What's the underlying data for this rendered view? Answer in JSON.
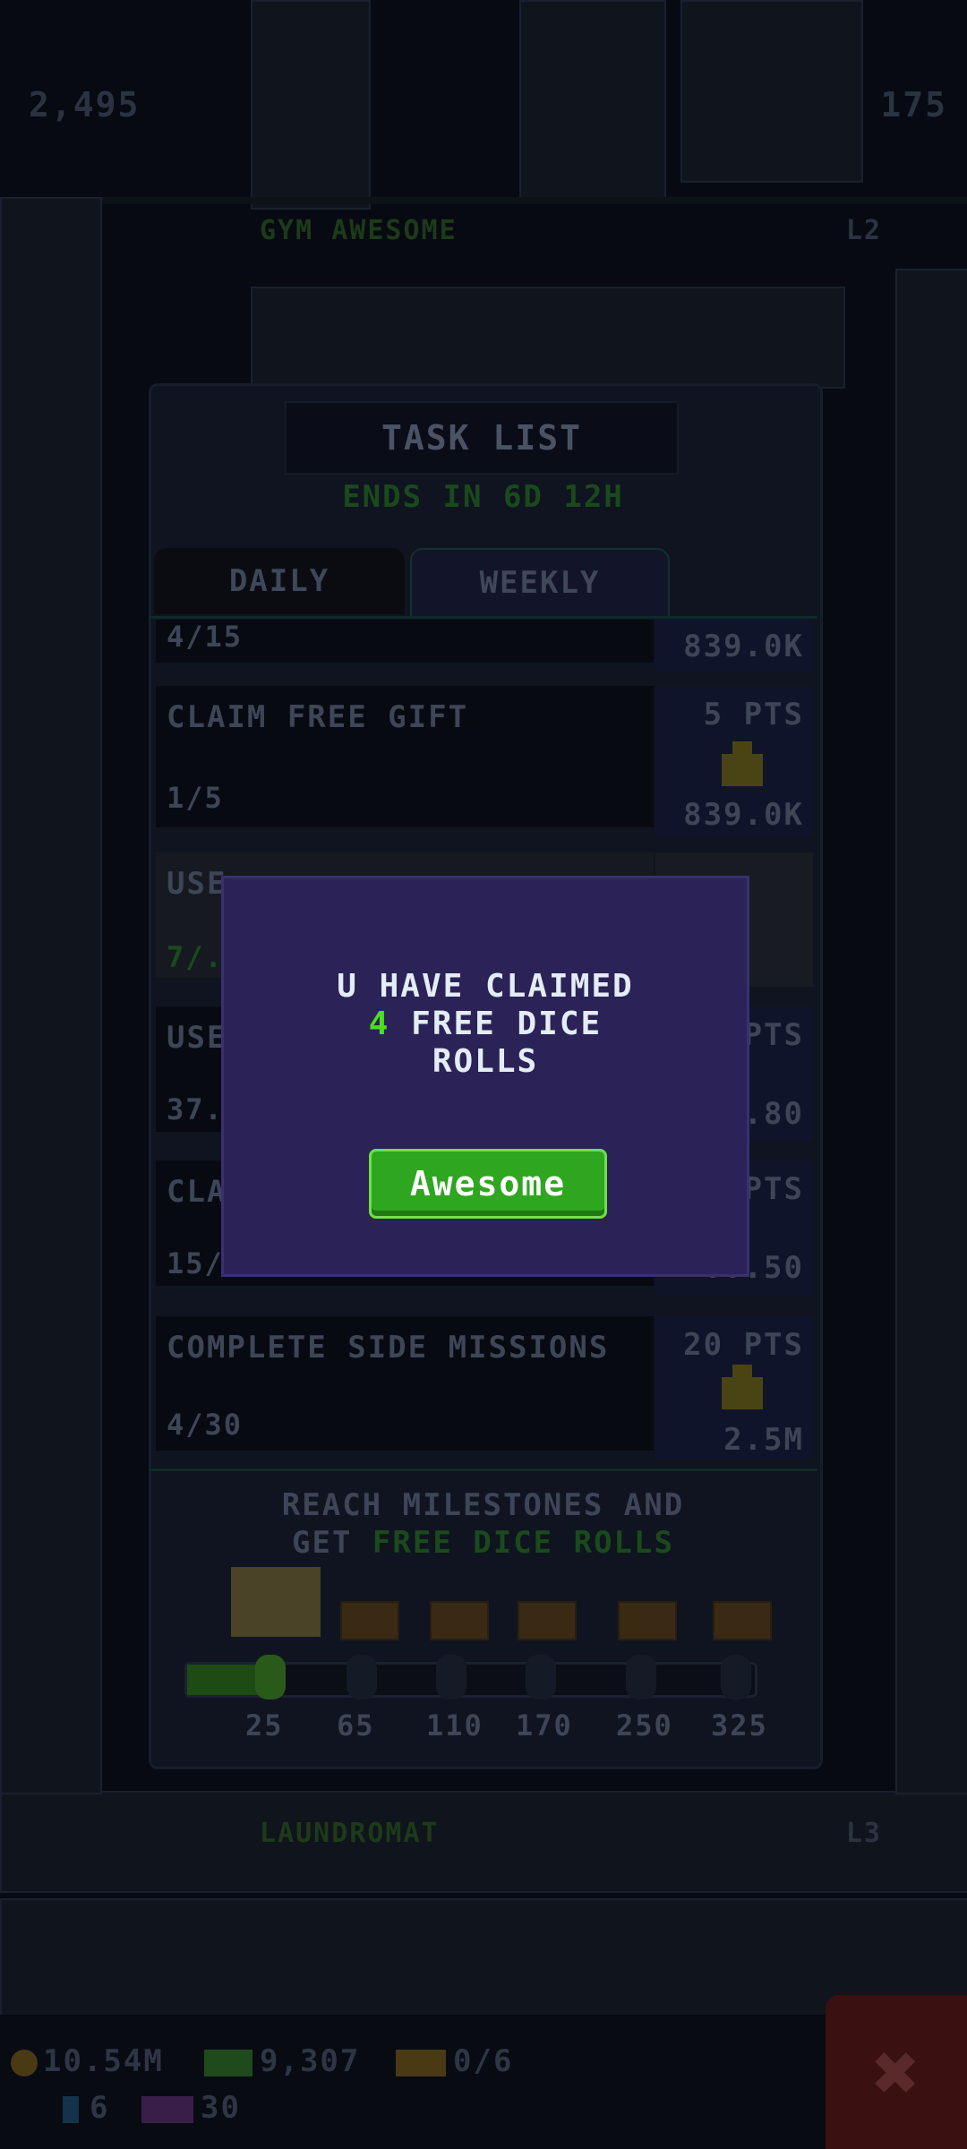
{
  "top": {
    "left_counter": "2,495",
    "right_counter": "175"
  },
  "floors": {
    "first_label": "Gym Awesome",
    "first_level": "L2",
    "bottom_label": "Laundromat",
    "bottom_level": "L3"
  },
  "task_list": {
    "title": "Task List",
    "ends_in": "Ends in 6d 12h",
    "tabs": [
      {
        "label": "Daily",
        "active": false
      },
      {
        "label": "Weekly",
        "active": true
      }
    ],
    "tasks": [
      {
        "name": "",
        "progress": "4/15",
        "points": "",
        "reward": "839.0K"
      },
      {
        "name": "Claim Free Gift",
        "progress": "1/5",
        "points": "5 PTS",
        "reward": "839.0K"
      },
      {
        "name": "Use ...",
        "progress": "7/...",
        "points": "",
        "reward": ""
      },
      {
        "name": "Use...",
        "progress": "37...",
        "points": "...PTS",
        "reward": "...80"
      },
      {
        "name": "Cla...",
        "progress": "15/...",
        "points": "...PTS",
        "reward": "...50"
      },
      {
        "name": "Complete Side Missions",
        "progress": "4/30",
        "points": "20 PTS",
        "reward": "2.5M"
      }
    ],
    "milestones": {
      "text_line1": "Reach milestones and",
      "text_get": "get",
      "text_free": "free dice rolls",
      "values": [
        "25",
        "65",
        "110",
        "170",
        "250",
        "325"
      ],
      "progress_points": 25
    }
  },
  "hud": {
    "coins": "10.54M",
    "cash": "9,307",
    "tickets": "0/6",
    "gems": "6",
    "vip": "30"
  },
  "modal": {
    "message_prefix": "U have claimed",
    "count": "4",
    "message_suffix": "free dice",
    "message_end": "rolls",
    "button_label": "Awesome"
  },
  "colors": {
    "modal_bg": "#2b2257",
    "button_green": "#2fa620",
    "highlight_green": "#4ae01a"
  },
  "icons": [
    "coin-icon",
    "cash-icon",
    "ticket-icon",
    "gem-icon",
    "vip-icon",
    "close-icon",
    "trophy-icon",
    "chest-icon"
  ]
}
